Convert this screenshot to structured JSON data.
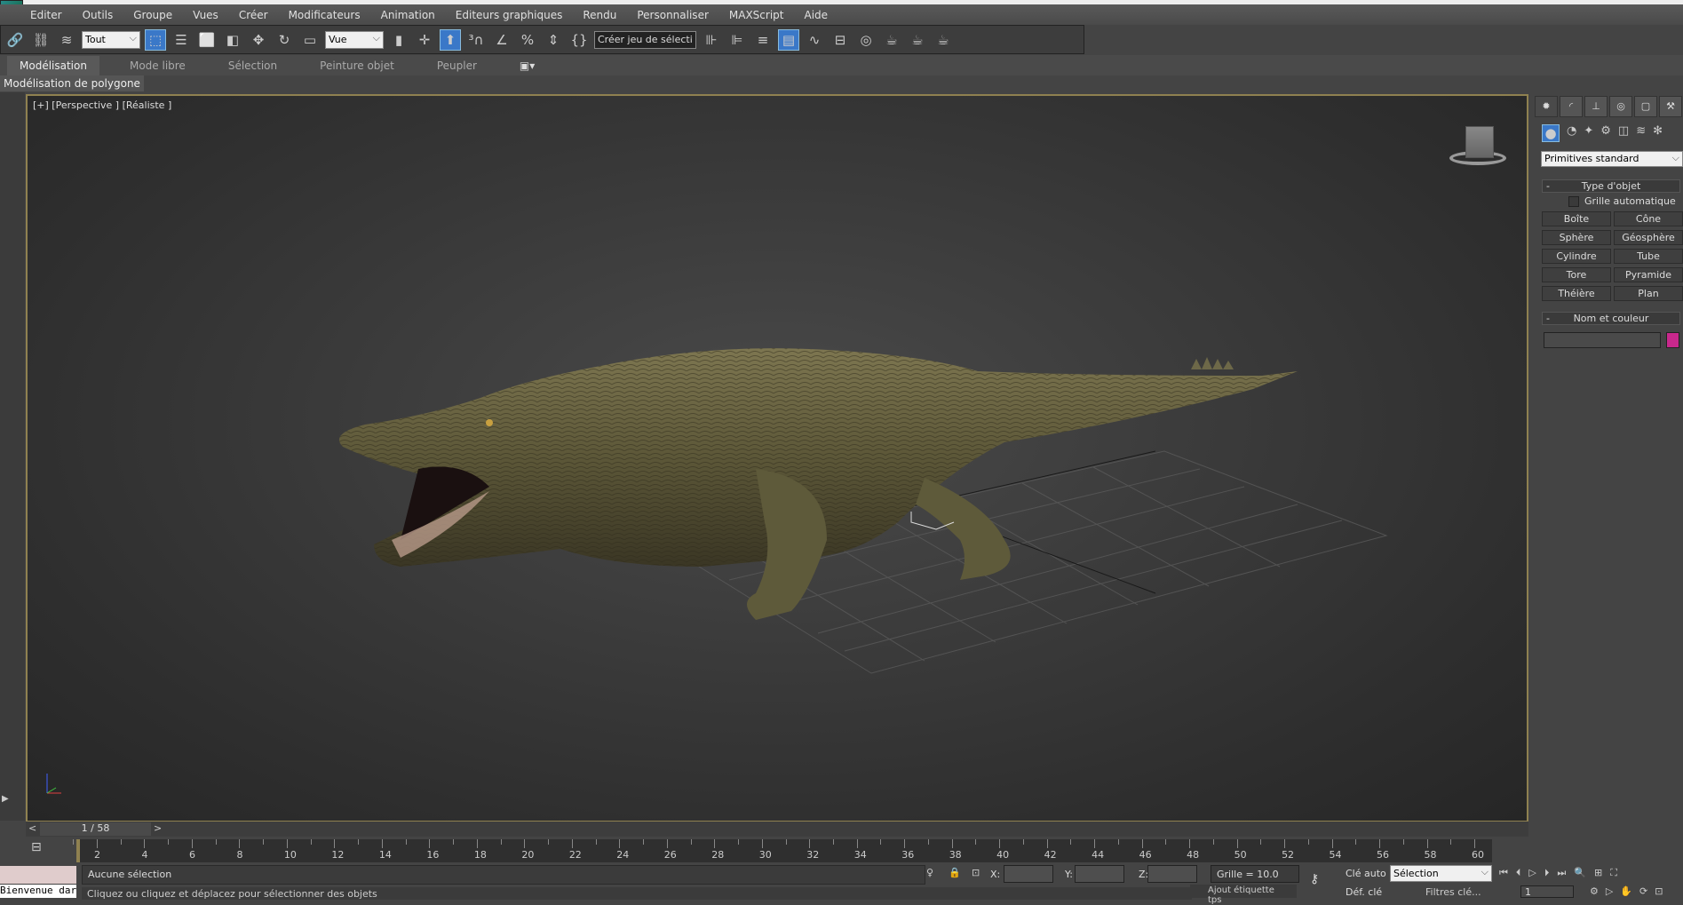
{
  "menu": [
    "Editer",
    "Outils",
    "Groupe",
    "Vues",
    "Créer",
    "Modificateurs",
    "Animation",
    "Editeurs graphiques",
    "Rendu",
    "Personnaliser",
    "MAXScript",
    "Aide"
  ],
  "toolbar": {
    "filter": "Tout",
    "coord_system": "Vue",
    "named_selection": "Créer jeu de sélecti"
  },
  "ribbon": {
    "tabs": [
      "Modélisation",
      "Mode libre",
      "Sélection",
      "Peinture objet",
      "Peupler"
    ],
    "active": "Modélisation",
    "panel_label": "Modélisation de polygone"
  },
  "viewport": {
    "label": "[+] [Perspective ] [Réaliste ]"
  },
  "command_panel": {
    "category": "Primitives standard",
    "rollout_type": "Type d'objet",
    "autogrid": "Grille automatique",
    "buttons": [
      "Boîte",
      "Cône",
      "Sphère",
      "Géosphère",
      "Cylindre",
      "Tube",
      "Tore",
      "Pyramide",
      "Théière",
      "Plan"
    ],
    "rollout_name": "Nom et couleur",
    "object_color": "#c8288c"
  },
  "timeline": {
    "frame": "1 / 58",
    "ticks": [
      "2",
      "4",
      "6",
      "8",
      "10",
      "12",
      "14",
      "16",
      "18",
      "20",
      "22",
      "24",
      "26",
      "28",
      "30",
      "32",
      "34",
      "36",
      "38",
      "40",
      "42",
      "44",
      "46",
      "48",
      "50",
      "52",
      "54",
      "56",
      "58",
      "60"
    ]
  },
  "status": {
    "selection": "Aucune sélection",
    "prompt": "Cliquez ou cliquez et déplacez pour sélectionner des objets",
    "welcome": "Bienvenue dar",
    "x_label": "X:",
    "y_label": "Y:",
    "z_label": "Z:",
    "grid": "Grille = 10.0",
    "auto_key": "Clé auto",
    "set_key": "Déf. clé",
    "key_mode": "Sélection",
    "filters": "Filtres clé...",
    "add_time_tag": "Ajout étiquette tps",
    "current_frame": "1"
  }
}
